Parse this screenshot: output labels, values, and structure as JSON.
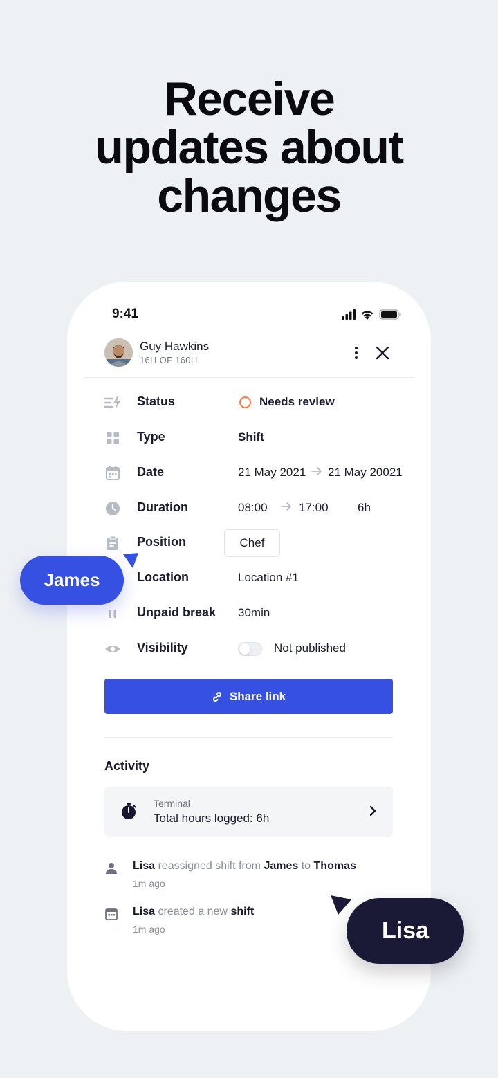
{
  "headline": [
    "Receive",
    "updates about",
    "changes"
  ],
  "status_bar": {
    "time": "9:41"
  },
  "header": {
    "user_name": "Guy Hawkins",
    "user_hours": "16H OF 160H"
  },
  "fields": {
    "status": {
      "label": "Status",
      "value": "Needs review",
      "indicator_color": "#ff7a45"
    },
    "type": {
      "label": "Type",
      "value": "Shift"
    },
    "date": {
      "label": "Date",
      "from": "21 May 2021",
      "to": "21 May 20021"
    },
    "duration": {
      "label": "Duration",
      "from": "08:00",
      "to": "17:00",
      "total": "6h"
    },
    "position": {
      "label": "Position",
      "value": "Chef"
    },
    "location": {
      "label": "Location",
      "value": "Location #1"
    },
    "unpaid_break": {
      "label": "Unpaid break",
      "value": "30min"
    },
    "visibility": {
      "label": "Visibility",
      "value": "Not published",
      "published": false
    }
  },
  "share_button": {
    "label": "Share link",
    "color": "#3650e2"
  },
  "activity": {
    "title": "Activity",
    "terminal": {
      "label": "Terminal",
      "value": "Total hours logged: 6h"
    },
    "logs": [
      {
        "actor": "Lisa",
        "action": "reassigned shift from",
        "from": "James",
        "connector": "to",
        "to": "Thomas",
        "time": "1m ago",
        "icon": "person-icon"
      },
      {
        "actor": "Lisa",
        "action": "created a new",
        "object": "shift",
        "time": "1m ago",
        "icon": "calendar-icon"
      }
    ]
  },
  "cursors": {
    "james": {
      "label": "James",
      "color": "#3650e2"
    },
    "lisa": {
      "label": "Lisa",
      "color": "#1b1a36"
    }
  }
}
